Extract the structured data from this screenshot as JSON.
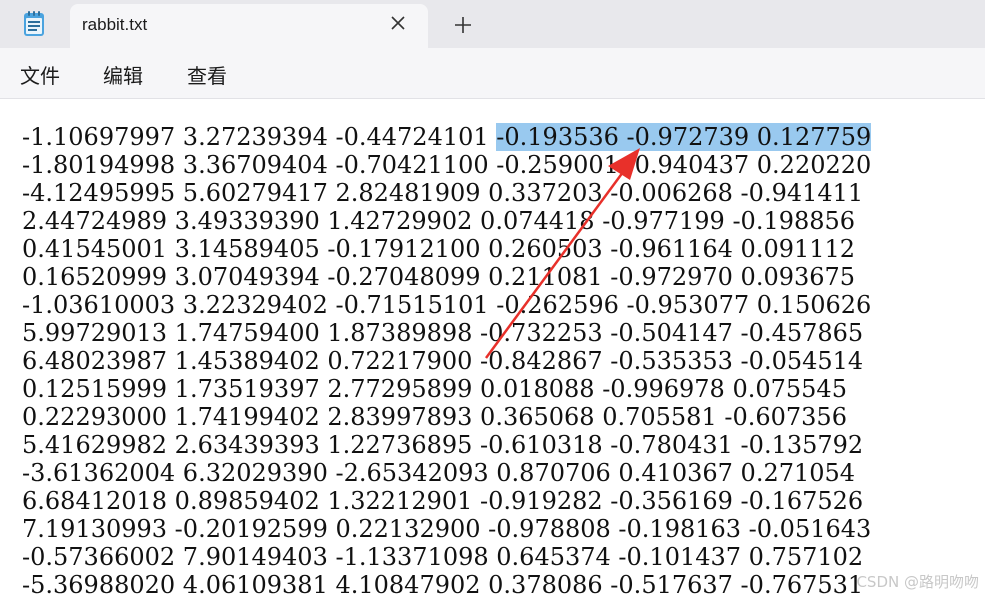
{
  "tab": {
    "title": "rabbit.txt"
  },
  "menu": {
    "file": "文件",
    "edit": "编辑",
    "view": "查看"
  },
  "editor": {
    "lines": [
      {
        "pre": "-1.10697997 3.27239394 -0.44724101 ",
        "sel": "-0.193536 -0.972739 0.127759"
      },
      {
        "pre": "-1.80194998 3.36709404 -0.70421100 -0.259001 -0.940437 0.220220",
        "sel": ""
      },
      {
        "pre": "-4.12495995 5.60279417 2.82481909 0.337203 -0.006268 -0.941411",
        "sel": ""
      },
      {
        "pre": "2.44724989 3.49339390 1.42729902 0.074418 -0.977199 -0.198856",
        "sel": ""
      },
      {
        "pre": "0.41545001 3.14589405 -0.17912100 0.260503 -0.961164 0.091112",
        "sel": ""
      },
      {
        "pre": "0.16520999 3.07049394 -0.27048099 0.211081 -0.972970 0.093675",
        "sel": ""
      },
      {
        "pre": "-1.03610003 3.22329402 -0.71515101 -0.262596 -0.953077 0.150626",
        "sel": ""
      },
      {
        "pre": "5.99729013 1.74759400 1.87389898 -0.732253 -0.504147 -0.457865",
        "sel": ""
      },
      {
        "pre": "6.48023987 1.45389402 0.72217900 -0.842867 -0.535353 -0.054514",
        "sel": ""
      },
      {
        "pre": "0.12515999 1.73519397 2.77295899 0.018088 -0.996978 0.075545",
        "sel": ""
      },
      {
        "pre": "0.22293000 1.74199402 2.83997893 0.365068 0.705581 -0.607356",
        "sel": ""
      },
      {
        "pre": "5.41629982 2.63439393 1.22736895 -0.610318 -0.780431 -0.135792",
        "sel": ""
      },
      {
        "pre": "-3.61362004 6.32029390 -2.65342093 0.870706 0.410367 0.271054",
        "sel": ""
      },
      {
        "pre": "6.68412018 0.89859402 1.32212901 -0.919282 -0.356169 -0.167526",
        "sel": ""
      },
      {
        "pre": "7.19130993 -0.20192599 0.22132900 -0.978808 -0.198163 -0.051643",
        "sel": ""
      },
      {
        "pre": "-0.57366002 7.90149403 -1.13371098 0.645374 -0.101437 0.757102",
        "sel": ""
      },
      {
        "pre": "-5.36988020 4.06109381 4.10847902 0.378086 -0.517637 -0.767531",
        "sel": ""
      }
    ]
  },
  "annotation": {
    "color": "#e8302a"
  },
  "watermark": "CSDN @路明吻吻",
  "colors": {
    "selection": "#99c9ef",
    "titlebar": "#e8e8ec",
    "menubar": "#f6f6f8"
  }
}
